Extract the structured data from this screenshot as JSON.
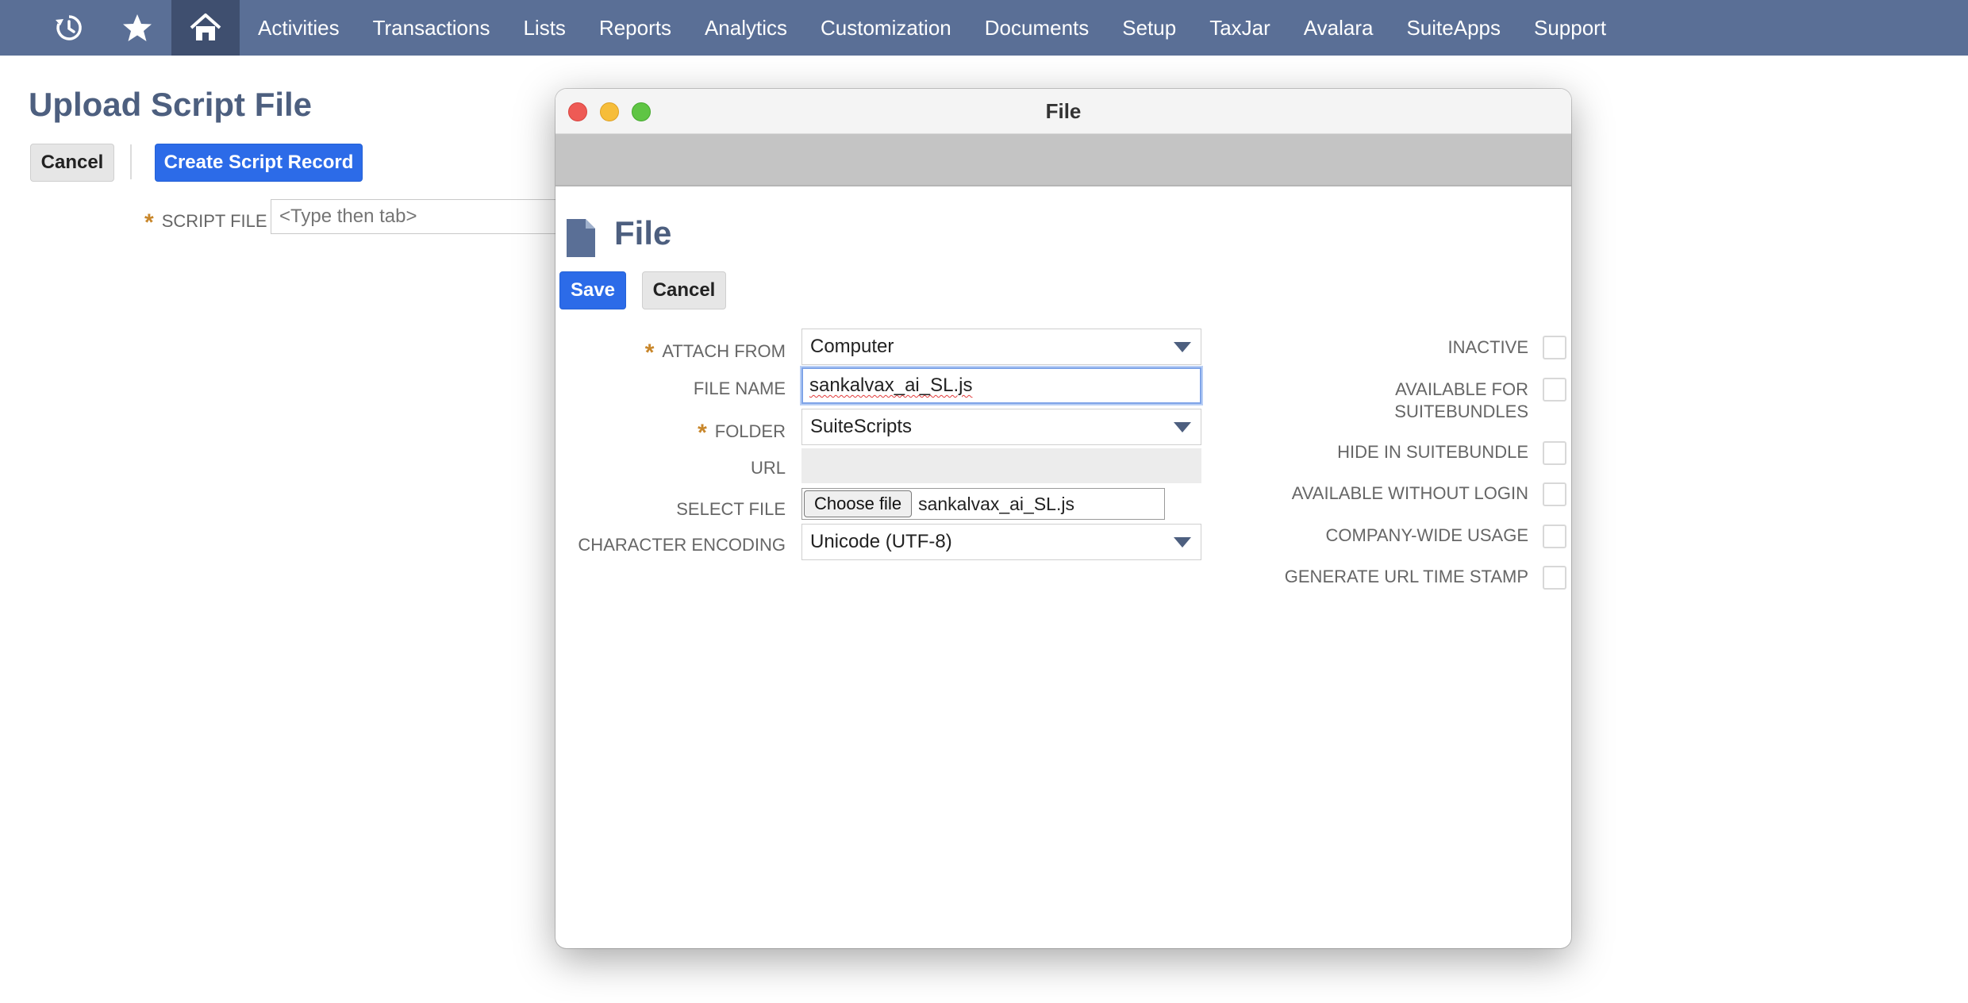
{
  "nav": {
    "icons": [
      "recent-history-icon",
      "star-icon",
      "home-icon"
    ],
    "items": [
      "Activities",
      "Transactions",
      "Lists",
      "Reports",
      "Analytics",
      "Customization",
      "Documents",
      "Setup",
      "TaxJar",
      "Avalara",
      "SuiteApps",
      "Support"
    ]
  },
  "page": {
    "title": "Upload Script File",
    "cancel_label": "Cancel",
    "create_label": "Create Script Record",
    "script_file_label": "SCRIPT FILE",
    "script_file_placeholder": "<Type then tab>"
  },
  "modal": {
    "window_title": "File",
    "heading": "File",
    "save_label": "Save",
    "cancel_label": "Cancel",
    "fields": {
      "attach_from_label": "ATTACH FROM",
      "attach_from_value": "Computer",
      "file_name_label": "FILE NAME",
      "file_name_value": "sankalvax_ai_SL.js",
      "folder_label": "FOLDER",
      "folder_value": "SuiteScripts",
      "url_label": "URL",
      "url_value": "",
      "select_file_label": "SELECT FILE",
      "choose_file_label": "Choose file",
      "chosen_file_name": "sankalvax_ai_SL.js",
      "encoding_label": "CHARACTER ENCODING",
      "encoding_value": "Unicode (UTF-8)"
    },
    "checkboxes": {
      "inactive": "INACTIVE",
      "available_for_suitebundles_1": "AVAILABLE FOR",
      "available_for_suitebundles_2": "SUITEBUNDLES",
      "hide_in_suitebundle": "HIDE IN SUITEBUNDLE",
      "available_without_login": "AVAILABLE WITHOUT LOGIN",
      "company_wide_usage": "COMPANY-WIDE USAGE",
      "generate_url_time_stamp": "GENERATE URL TIME STAMP"
    }
  },
  "colors": {
    "nav_bg": "#5a6f96",
    "accent_blue": "#2c6be8",
    "heading": "#4d5f7f",
    "required_star": "#c8862a"
  }
}
